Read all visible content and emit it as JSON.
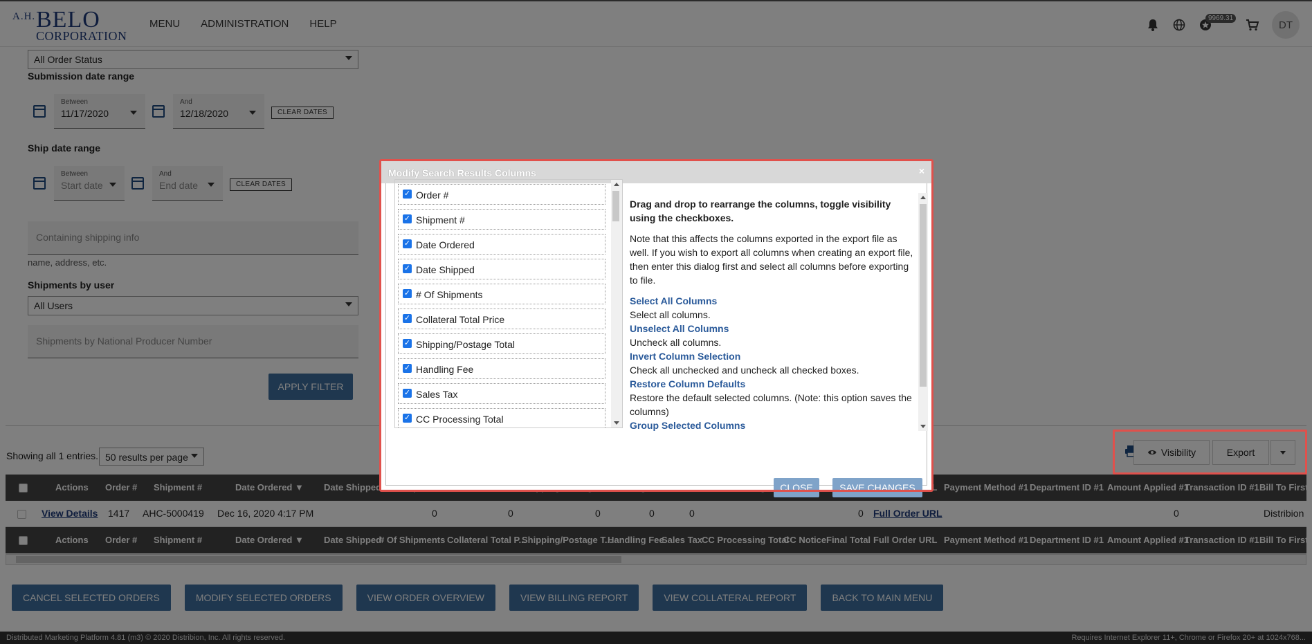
{
  "header": {
    "logo": {
      "ah": "A.H.",
      "belo": "BELO",
      "corp": "CORPORATION"
    },
    "nav": [
      "MENU",
      "ADMINISTRATION",
      "HELP"
    ],
    "points": "9969.31",
    "avatar_initials": "DT"
  },
  "filters": {
    "order_status": "All Order Status",
    "submission_label": "Submission date range",
    "between_label": "Between",
    "and_label": "And",
    "submission_start": "11/17/2020",
    "submission_end": "12/18/2020",
    "clear_dates": "CLEAR DATES",
    "ship_label": "Ship date range",
    "ship_start_placeholder": "Start date",
    "ship_end_placeholder": "End date",
    "shipping_info_placeholder": "Containing shipping info",
    "shipping_info_help": "name, address, etc.",
    "shipments_user_label": "Shipments by user",
    "shipments_user_value": "All Users",
    "npn_placeholder": "Shipments by National Producer Number",
    "apply": "APPLY FILTER"
  },
  "results": {
    "showing": "Showing all 1 entries.",
    "per_page": "50 results per page",
    "visibility": "Visibility",
    "export": "Export"
  },
  "table": {
    "headers": [
      "Actions",
      "Order #",
      "Shipment #",
      "Date Ordered ▼",
      "Date Shipped",
      "# Of Shipments",
      "Collateral Total P...",
      "Shipping/Postage T...",
      "Handling Fee",
      "Sales Tax",
      "CC Processing Total",
      "CC Notice",
      "Final Total",
      "Full Order URL",
      "Payment Method #1",
      "Department ID #1",
      "Amount Applied #1",
      "Transaction ID #1",
      "Bill To First"
    ],
    "row": {
      "actions": "View Details",
      "order": "1417",
      "shipment": "AHC-5000419",
      "date_ordered": "Dec 16, 2020 4:17 PM",
      "num_shipments": "0",
      "collateral": "0",
      "shipping": "0",
      "handling": "0",
      "sales_tax": "0",
      "final_total": "0",
      "full_order_url": "Full Order URL",
      "amount_applied": "0",
      "bill_to": "Distribion"
    }
  },
  "actions": [
    "CANCEL SELECTED ORDERS",
    "MODIFY SELECTED ORDERS",
    "VIEW ORDER OVERVIEW",
    "VIEW BILLING REPORT",
    "VIEW COLLATERAL REPORT",
    "BACK TO MAIN MENU"
  ],
  "footer": {
    "left": "Distributed Marketing Platform 4.81 (m3)   © 2020 Distribion, Inc. All rights reserved.",
    "right": "Requires Internet Explorer 11+, Chrome or Firefox 20+ at 1024x768..."
  },
  "modal": {
    "title": "Modify Search Results Columns",
    "close_x": "×",
    "columns": [
      "Order #",
      "Shipment #",
      "Date Ordered",
      "Date Shipped",
      "# Of Shipments",
      "Collateral Total Price",
      "Shipping/Postage Total",
      "Handling Fee",
      "Sales Tax",
      "CC Processing Total"
    ],
    "intro": "Drag and drop to rearrange the columns, toggle visibility using the checkboxes.",
    "note": "Note that this affects the columns exported in the export file as well. If you wish to export all columns when creating an export file, then enter this dialog first and select all columns before exporting to file.",
    "options": [
      {
        "link": "Select All Columns",
        "desc": "Select all columns."
      },
      {
        "link": "Unselect All Columns",
        "desc": "Uncheck all columns."
      },
      {
        "link": "Invert Column Selection",
        "desc": "Check all unchecked and uncheck all checked boxes."
      },
      {
        "link": "Restore Column Defaults",
        "desc": "Restore the default selected columns. (Note: this option saves the columns)"
      },
      {
        "link": "Group Selected Columns",
        "desc": ""
      }
    ],
    "close": "CLOSE",
    "save": "SAVE CHANGES"
  },
  "colors": {
    "accent": "#3e6f9e",
    "highlight": "#e0514c",
    "link": "#2a5a9a"
  }
}
